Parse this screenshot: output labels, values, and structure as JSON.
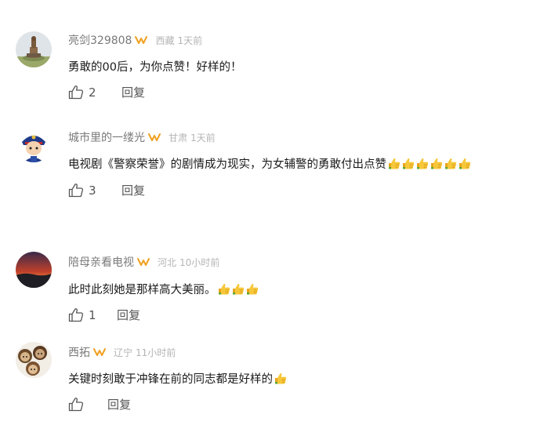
{
  "comments": [
    {
      "username": "亮剑329808",
      "location": "西藏",
      "time": "1天前",
      "text": "勇敢的00后，为你点赞！好样的！",
      "thumbs_emoji_count": 0,
      "like_count": "2",
      "reply_label": "回复"
    },
    {
      "username": "城市里的一缕光",
      "location": "甘肃",
      "time": "1天前",
      "text": "电视剧《警察荣誉》的剧情成为现实，为女辅警的勇敢付出点赞",
      "thumbs_emoji_count": 6,
      "like_count": "3",
      "reply_label": "回复"
    },
    {
      "username": "陪母亲看电视",
      "location": "河北",
      "time": "10小时前",
      "text": "此时此刻她是那样高大美丽。",
      "thumbs_emoji_count": 3,
      "like_count": "1",
      "reply_label": "回复"
    },
    {
      "username": "西拓",
      "location": "辽宁",
      "time": "11小时前",
      "text": "关键时刻敢于冲锋在前的同志都是好样的",
      "thumbs_emoji_count": 1,
      "like_count": "",
      "reply_label": "回复"
    }
  ],
  "colors": {
    "username": "#7a7a7a",
    "meta": "#b4b4b4",
    "text": "#1a1a1a",
    "action": "#555555",
    "vip_badge": "#f0a020"
  },
  "icons": {
    "vip_badge": "vip-badge-icon",
    "thumbs_emoji": "thumbs-up-emoji-icon",
    "like": "thumbs-up-outline-icon"
  }
}
